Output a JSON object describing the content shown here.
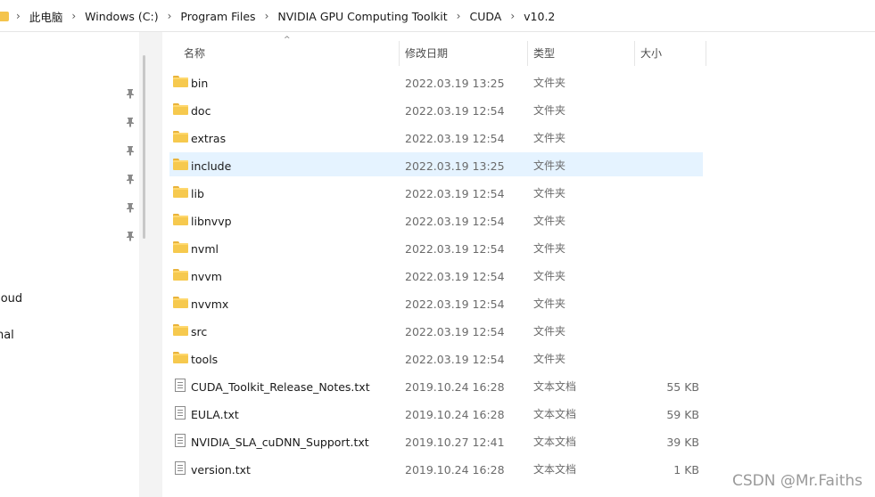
{
  "address_bar": {
    "crumbs": [
      "此电脑",
      "Windows (C:)",
      "Program Files",
      "NVIDIA GPU Computing Toolkit",
      "CUDA",
      "v10.2"
    ]
  },
  "nav": {
    "items": [
      "Cloud",
      "onal"
    ]
  },
  "columns": {
    "name": "名称",
    "modified": "修改日期",
    "type": "类型",
    "size": "大小"
  },
  "files": [
    {
      "name": "bin",
      "modified": "2022.03.19 13:25",
      "type": "文件夹",
      "size": "",
      "icon": "folder-icon"
    },
    {
      "name": "doc",
      "modified": "2022.03.19 12:54",
      "type": "文件夹",
      "size": "",
      "icon": "folder-icon"
    },
    {
      "name": "extras",
      "modified": "2022.03.19 12:54",
      "type": "文件夹",
      "size": "",
      "icon": "folder-icon"
    },
    {
      "name": "include",
      "modified": "2022.03.19 13:25",
      "type": "文件夹",
      "size": "",
      "icon": "folder-icon",
      "selected": true
    },
    {
      "name": "lib",
      "modified": "2022.03.19 12:54",
      "type": "文件夹",
      "size": "",
      "icon": "folder-icon"
    },
    {
      "name": "libnvvp",
      "modified": "2022.03.19 12:54",
      "type": "文件夹",
      "size": "",
      "icon": "folder-icon"
    },
    {
      "name": "nvml",
      "modified": "2022.03.19 12:54",
      "type": "文件夹",
      "size": "",
      "icon": "folder-icon"
    },
    {
      "name": "nvvm",
      "modified": "2022.03.19 12:54",
      "type": "文件夹",
      "size": "",
      "icon": "folder-icon"
    },
    {
      "name": "nvvmx",
      "modified": "2022.03.19 12:54",
      "type": "文件夹",
      "size": "",
      "icon": "folder-icon"
    },
    {
      "name": "src",
      "modified": "2022.03.19 12:54",
      "type": "文件夹",
      "size": "",
      "icon": "folder-icon"
    },
    {
      "name": "tools",
      "modified": "2022.03.19 12:54",
      "type": "文件夹",
      "size": "",
      "icon": "folder-icon"
    },
    {
      "name": "CUDA_Toolkit_Release_Notes.txt",
      "modified": "2019.10.24 16:28",
      "type": "文本文档",
      "size": "55 KB",
      "icon": "text-file-icon"
    },
    {
      "name": "EULA.txt",
      "modified": "2019.10.24 16:28",
      "type": "文本文档",
      "size": "59 KB",
      "icon": "text-file-icon"
    },
    {
      "name": "NVIDIA_SLA_cuDNN_Support.txt",
      "modified": "2019.10.27 12:41",
      "type": "文本文档",
      "size": "39 KB",
      "icon": "text-file-icon"
    },
    {
      "name": "version.txt",
      "modified": "2019.10.24 16:28",
      "type": "文本文档",
      "size": "1 KB",
      "icon": "text-file-icon"
    }
  ],
  "watermark": "CSDN @Mr.Faiths",
  "colors": {
    "selected_row": "#e5f3ff",
    "folder": "#f6c94e"
  }
}
